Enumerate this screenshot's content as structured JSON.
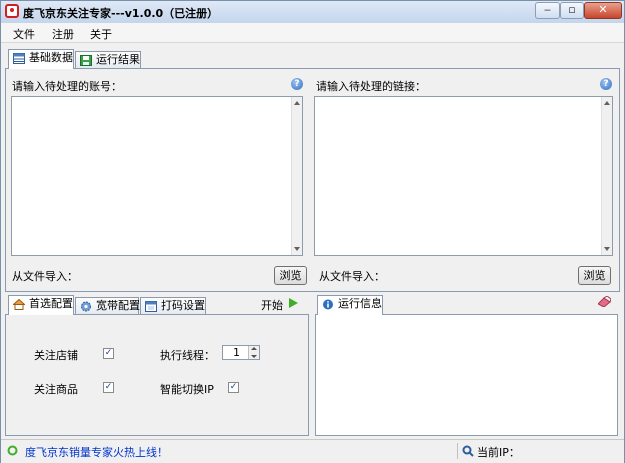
{
  "window": {
    "title": "度飞京东关注专家---v1.0.0（已注册）",
    "controls": [
      "minimize",
      "restore",
      "close"
    ]
  },
  "menu": {
    "items": [
      "文件",
      "注册",
      "关于"
    ]
  },
  "top_tabs": [
    {
      "label": "基础数据",
      "icon": "table-icon",
      "active": true
    },
    {
      "label": "运行结果",
      "icon": "save-icon",
      "active": false
    }
  ],
  "basic": {
    "accounts_label": "请输入待处理的账号：",
    "links_label": "请输入待处理的链接：",
    "accounts_value": "",
    "links_value": "",
    "import_label_left": "从文件导入：",
    "import_label_right": "从文件导入：",
    "browse_left": "浏览",
    "browse_right": "浏览",
    "help_glyph": "?"
  },
  "bottom_tabs": [
    {
      "label": "首选配置",
      "icon": "home-icon",
      "active": true
    },
    {
      "label": "宽带配置",
      "icon": "gear-icon",
      "active": false
    },
    {
      "label": "打码设置",
      "icon": "window-icon",
      "active": false
    }
  ],
  "start": {
    "label": "开始"
  },
  "settings": {
    "follow_store": {
      "label": "关注店铺",
      "checked": true
    },
    "follow_product": {
      "label": "关注商品",
      "checked": true
    },
    "threads_label": "执行线程：",
    "threads_value": "1",
    "smart_ip": {
      "label": "智能切换IP",
      "checked": true
    }
  },
  "run_info": {
    "tab_label": "运行信息",
    "icon": "info-icon",
    "clear_icon": "eraser-icon"
  },
  "status": {
    "message": "度飞京东销量专家火热上线！",
    "ip_label": "当前IP：",
    "ip_value": ""
  },
  "colors": {
    "status_link": "#0033cc",
    "start_arrow": "#3fae2a",
    "help": "#2f6fc0"
  }
}
